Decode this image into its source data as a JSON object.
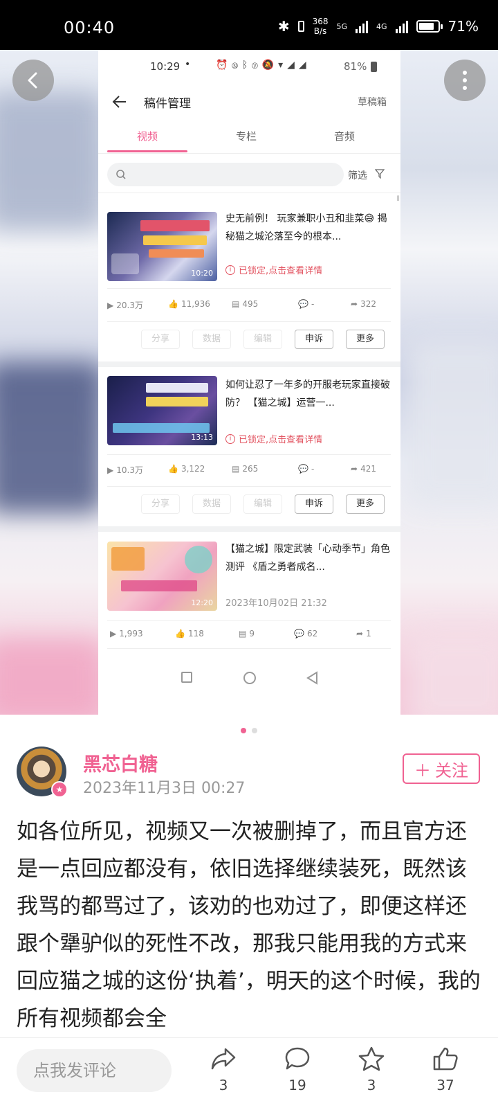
{
  "status_bar": {
    "time": "00:40",
    "speed_top": "368",
    "speed_bottom": "B/s",
    "net1": "5G",
    "net2": "4G",
    "battery": "71%"
  },
  "screenshot": {
    "status": {
      "time": "10:29",
      "battery": "81%"
    },
    "header": {
      "title": "稿件管理",
      "drafts": "草稿箱"
    },
    "tabs": [
      "视频",
      "专栏",
      "音频"
    ],
    "filter_label": "筛选",
    "videos": [
      {
        "title": "史无前例！ 玩家兼职小丑和韭菜😅 揭秘猫之城沦落至今的根本...",
        "duration": "10:20",
        "status": "已锁定,点击查看详情",
        "views": "20.3万",
        "likes": "11,936",
        "danmaku": "495",
        "comments": "-",
        "shares": "322",
        "actions": [
          "分享",
          "数据",
          "编辑",
          "申诉",
          "更多"
        ]
      },
      {
        "title": "如何让忍了一年多的开服老玩家直接破防？ 【猫之城】运营一...",
        "duration": "13:13",
        "status": "已锁定,点击查看详情",
        "views": "10.3万",
        "likes": "3,122",
        "danmaku": "265",
        "comments": "-",
        "shares": "421",
        "actions": [
          "分享",
          "数据",
          "编辑",
          "申诉",
          "更多"
        ]
      },
      {
        "title": "【猫之城】限定武装「心动季节」角色测评 《盾之勇者成名...",
        "duration": "12:20",
        "status": "2023年10月02日 21:32",
        "views": "1,993",
        "likes": "118",
        "danmaku": "9",
        "comments": "62",
        "shares": "1"
      }
    ]
  },
  "post": {
    "author": "黑芯白糖",
    "date": "2023年11月3日 00:27",
    "follow_label": "关注",
    "content": "如各位所见，视频又一次被删掉了，而且官方还是一点回应都没有，依旧选择继续装死，既然该我骂的都骂过了，该劝的也劝过了，即便这样还跟个犟驴似的死性不改，那我只能用我的方式来回应猫之城的这份‘执着’，明天的这个时候，我的所有视频都会全"
  },
  "bottom": {
    "comment_placeholder": "点我发评论",
    "shares": "3",
    "comments": "19",
    "favorites": "3",
    "likes": "37"
  },
  "colors": {
    "accent": "#f06292",
    "lock_red": "#e2525f"
  },
  "pagination": {
    "current": 1,
    "total": 2
  }
}
